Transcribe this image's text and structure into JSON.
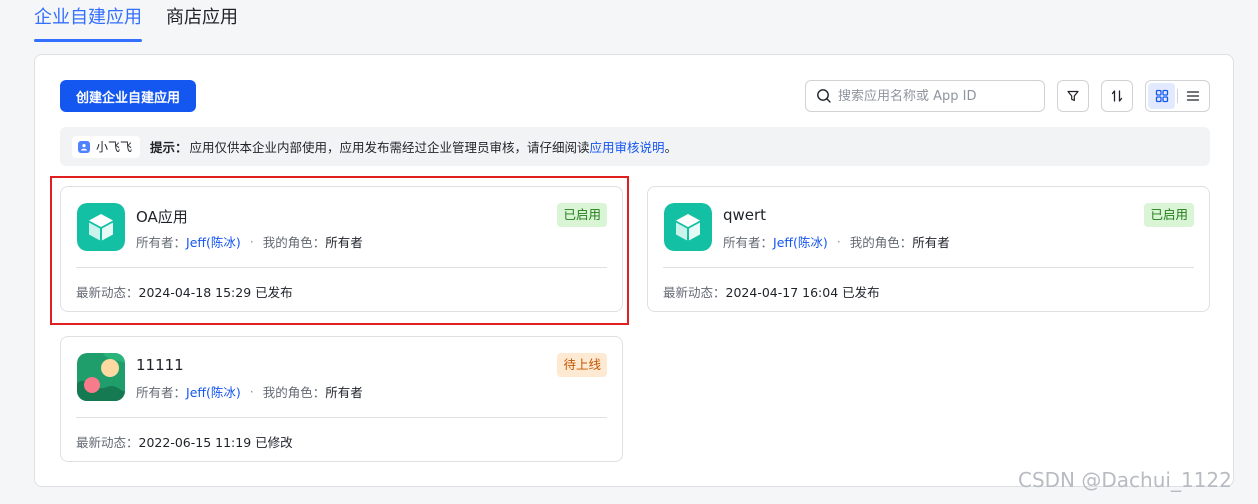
{
  "tabs": [
    {
      "label": "企业自建应用",
      "active": true
    },
    {
      "label": "商店应用",
      "active": false
    }
  ],
  "toolbar": {
    "create_label": "创建企业自建应用",
    "search_placeholder": "搜索应用名称或 App ID"
  },
  "notice": {
    "user_name": "小飞飞",
    "tip_label": "提示：",
    "tip_text": "应用仅供本企业内部使用，应用发布需经过企业管理员审核，请仔细阅读 ",
    "tip_link": "应用审核说明",
    "tip_end": "。"
  },
  "labels": {
    "owner": "所有者：",
    "role": "我的角色：",
    "activity": "最新动态："
  },
  "apps": [
    {
      "name": "OA应用",
      "owner": "Jeff(陈冰)",
      "role": "所有者",
      "status": "已启用",
      "activity": "2024-04-18 15:29 已发布"
    },
    {
      "name": "qwert",
      "owner": "Jeff(陈冰)",
      "role": "所有者",
      "status": "已启用",
      "activity": "2024-04-17 16:04 已发布"
    },
    {
      "name": "11111",
      "owner": "Jeff(陈冰)",
      "role": "所有者",
      "status": "待上线",
      "activity": "2022-06-15 11:19 已修改"
    }
  ],
  "colors": {
    "accent": "#1456f0",
    "enabled": "#237b19",
    "pending": "#c25705",
    "highlight": "#e02020"
  },
  "watermark": "CSDN @Dachui_1122"
}
